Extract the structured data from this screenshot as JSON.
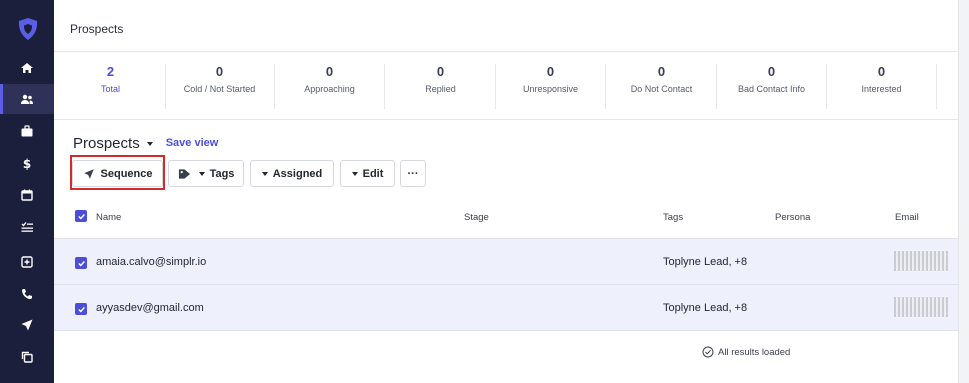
{
  "sidebar": {
    "logo_icon": "shield-logo-icon",
    "items": [
      {
        "name": "home",
        "icon": "home-icon"
      },
      {
        "name": "prospects",
        "icon": "people-icon",
        "active": true
      },
      {
        "name": "accounts",
        "icon": "briefcase-icon"
      },
      {
        "name": "opportunities",
        "icon": "dollar-icon"
      },
      {
        "name": "calendar",
        "icon": "calendar-icon"
      },
      {
        "name": "tasks",
        "icon": "checklist-icon"
      },
      {
        "name": "add",
        "icon": "plus-box-icon"
      },
      {
        "name": "calls",
        "icon": "phone-icon"
      },
      {
        "name": "sequences",
        "icon": "send-icon"
      },
      {
        "name": "templates",
        "icon": "copy-icon"
      }
    ]
  },
  "header": {
    "title": "Prospects"
  },
  "stats": [
    {
      "value": "2",
      "label": "Total",
      "active": true
    },
    {
      "value": "0",
      "label": "Cold / Not Started"
    },
    {
      "value": "0",
      "label": "Approaching"
    },
    {
      "value": "0",
      "label": "Replied"
    },
    {
      "value": "0",
      "label": "Unresponsive"
    },
    {
      "value": "0",
      "label": "Do Not Contact"
    },
    {
      "value": "0",
      "label": "Bad Contact Info"
    },
    {
      "value": "0",
      "label": "Interested"
    }
  ],
  "view": {
    "title": "Prospects",
    "save_label": "Save view"
  },
  "toolbar": {
    "sequence_label": "Sequence",
    "tags_label": "Tags",
    "assigned_label": "Assigned",
    "edit_label": "Edit",
    "more_label": "···"
  },
  "table": {
    "columns": {
      "name": "Name",
      "stage": "Stage",
      "tags": "Tags",
      "persona": "Persona",
      "email": "Email"
    },
    "rows": [
      {
        "email": "amaia.calvo@simplr.io",
        "tags": "Toplyne Lead,  +8"
      },
      {
        "email": "ayyasdev@gmail.com",
        "tags": "Toplyne Lead,  +8"
      }
    ]
  },
  "footer": {
    "status": "All results loaded"
  },
  "colors": {
    "accent": "#4b4fd8",
    "sidebar": "#1c1f3c",
    "highlight": "#d42a2a",
    "row_selected": "#eef1fb"
  }
}
